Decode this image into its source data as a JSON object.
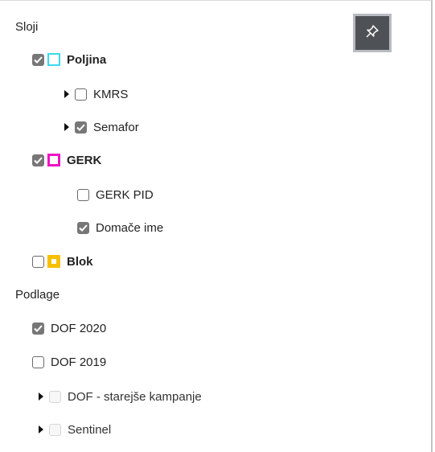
{
  "sections": {
    "layers_title": "Sloji",
    "base_title": "Podlage"
  },
  "layers": {
    "poljina": {
      "label": "Poljina",
      "checked": true,
      "swatch_color": "#39d9f0"
    },
    "kmrs": {
      "label": "KMRS",
      "checked": false
    },
    "semafor": {
      "label": "Semafor",
      "checked": true
    },
    "gerk": {
      "label": "GERK",
      "checked": true,
      "swatch_color": "#ee0fc7"
    },
    "gerk_pid": {
      "label": "GERK PID",
      "checked": false
    },
    "domace_ime": {
      "label": "Domače ime",
      "checked": true
    },
    "blok": {
      "label": "Blok",
      "checked": false,
      "swatch_color": "#f5c000"
    }
  },
  "base_layers": {
    "dof2020": {
      "label": "DOF 2020",
      "checked": true
    },
    "dof2019": {
      "label": "DOF 2019",
      "checked": false
    },
    "dof_old": {
      "label": "DOF - starejše kampanje",
      "disabled": true
    },
    "sentinel": {
      "label": "Sentinel",
      "disabled": true
    }
  },
  "icons": {
    "pin": "pin-icon",
    "expand": "caret-right-icon",
    "check": "check-icon"
  },
  "colors": {
    "pin_button_bg": "#4e5156",
    "checkbox_checked": "#777777"
  }
}
